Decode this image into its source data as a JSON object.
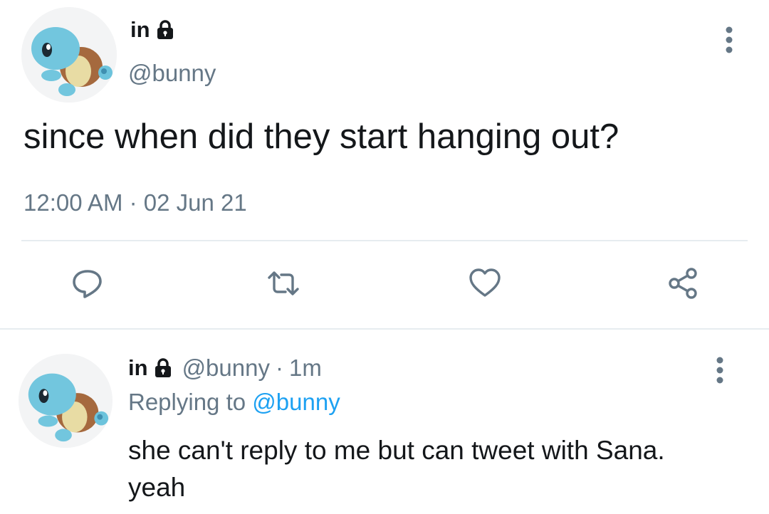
{
  "main_tweet": {
    "display_name": "in",
    "handle": "@bunny",
    "text": "since when did they start hanging out?",
    "time": "12:00 AM",
    "separator": "·",
    "date": "02 Jun 21",
    "avatar_icon": "squirtle-avatar",
    "icons": {
      "reply": "reply-icon",
      "retweet": "retweet-icon",
      "like": "heart-icon",
      "share": "share-icon",
      "more": "more-vertical-icon",
      "lock": "lock-icon"
    }
  },
  "reply_tweet": {
    "display_name": "in",
    "handle": "@bunny",
    "separator": "·",
    "age": "1m",
    "replying_prefix": "Replying to",
    "replying_to": "@bunny",
    "text": "she can't reply to me but can tweet with Sana. yeah"
  },
  "colors": {
    "text_primary": "#14171a",
    "text_secondary": "#657786",
    "link": "#1da1f2",
    "divider": "#e6ecf0"
  }
}
